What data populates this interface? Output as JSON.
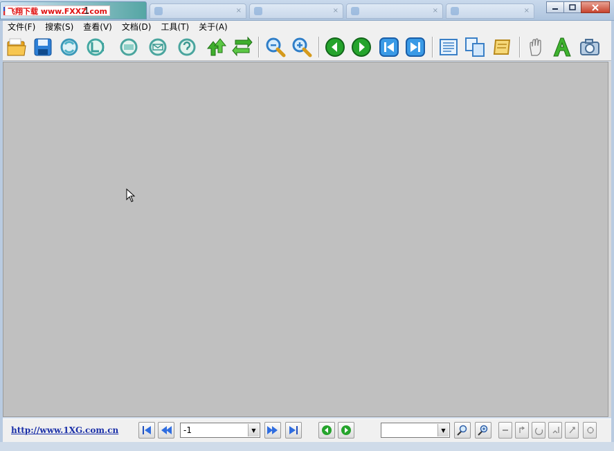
{
  "window": {
    "watermark": "飞翔下载 www.FXXZ.com",
    "title": "1",
    "minimize": "▭",
    "maximize": "▢",
    "close": "✕"
  },
  "menu": [
    "文件(F)",
    "搜索(S)",
    "查看(V)",
    "文档(D)",
    "工具(T)",
    "关于(A)"
  ],
  "status": {
    "link": "http://www.1XG.com.cn",
    "page_value": "-1",
    "zoom_value": ""
  },
  "colors": {
    "content_bg": "#c0c0c0",
    "link": "#1a2fa8"
  }
}
